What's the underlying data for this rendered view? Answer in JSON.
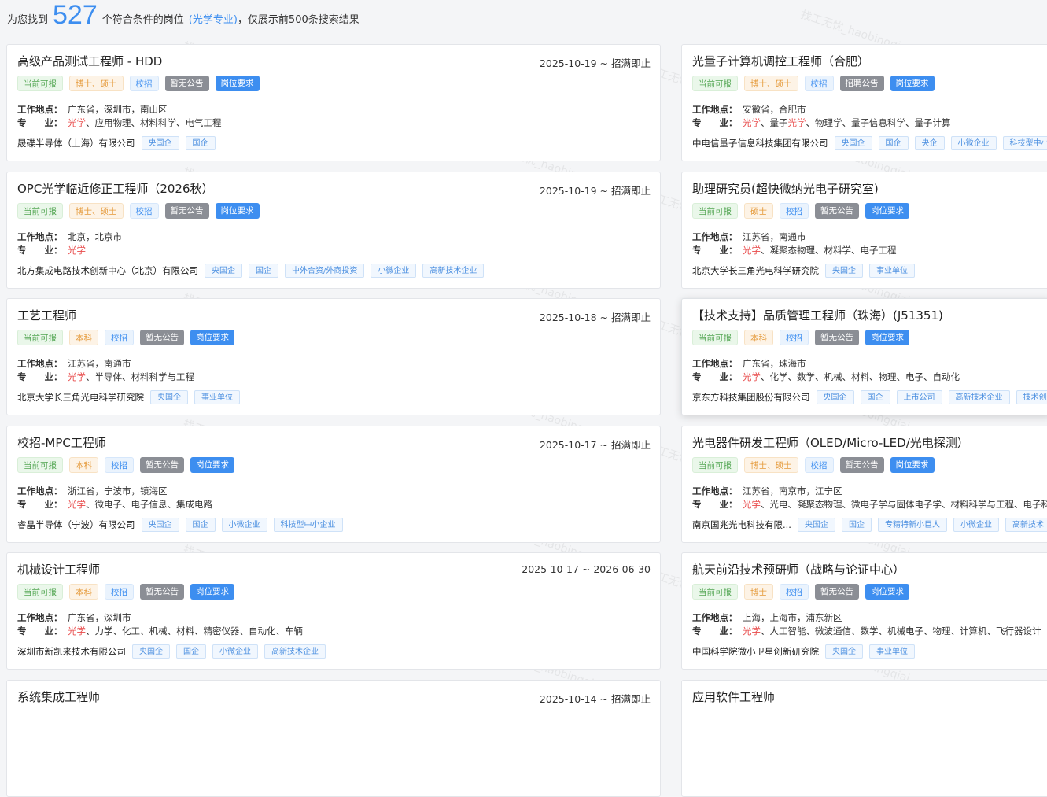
{
  "summary": {
    "prefix": "为您找到",
    "count": "527",
    "middle": "个符合条件的岗位",
    "major": "(光学专业)",
    "suffix": "，仅展示前500条搜索结果"
  },
  "labels": {
    "location": "工作地点：",
    "major": "专　　业："
  },
  "watermark": "找工无忧_haobingqiai",
  "left_jobs": [
    {
      "title": "高级产品测试工程师 - HDD",
      "date": "2025-10-19 ~ 招满即止",
      "tags": [
        "当前可报",
        "博士、硕士",
        "校招",
        "暂无公告",
        "岗位要求"
      ],
      "location": "广东省，深圳市，南山区",
      "major_hl": "光学",
      "major_rest": "、应用物理、材料科学、电气工程",
      "company": "晟碟半导体（上海）有限公司",
      "company_tags": [
        "央国企",
        "国企"
      ]
    },
    {
      "title": "OPC光学临近修正工程师（2026秋）",
      "date": "2025-10-19 ~ 招满即止",
      "tags": [
        "当前可报",
        "博士、硕士",
        "校招",
        "暂无公告",
        "岗位要求"
      ],
      "location": "北京，北京市",
      "major_hl": "光学",
      "major_rest": "",
      "company": "北方集成电路技术创新中心（北京）有限公司",
      "company_tags": [
        "央国企",
        "国企",
        "中外合资/外商投资",
        "小微企业",
        "高新技术企业"
      ]
    },
    {
      "title": "工艺工程师",
      "date": "2025-10-18 ~ 招满即止",
      "tags": [
        "当前可报",
        "本科",
        "校招",
        "暂无公告",
        "岗位要求"
      ],
      "location": "江苏省，南通市",
      "major_hl": "光学",
      "major_rest": "、半导体、材料科学与工程",
      "company": "北京大学长三角光电科学研究院",
      "company_tags": [
        "央国企",
        "事业单位"
      ]
    },
    {
      "title": "校招-MPC工程师",
      "date": "2025-10-17 ~ 招满即止",
      "tags": [
        "当前可报",
        "本科",
        "校招",
        "暂无公告",
        "岗位要求"
      ],
      "location": "浙江省，宁波市，镇海区",
      "major_hl": "光学",
      "major_rest": "、微电子、电子信息、集成电路",
      "company": "睿晶半导体（宁波）有限公司",
      "company_tags": [
        "央国企",
        "国企",
        "小微企业",
        "科技型中小企业"
      ]
    },
    {
      "title": "机械设计工程师",
      "date": "2025-10-17 ~ 2026-06-30",
      "tags": [
        "当前可报",
        "本科",
        "校招",
        "暂无公告",
        "岗位要求"
      ],
      "location": "广东省，深圳市",
      "major_hl": "光学",
      "major_rest": "、力学、化工、机械、材料、精密仪器、自动化、车辆",
      "company": "深圳市新凯来技术有限公司",
      "company_tags": [
        "央国企",
        "国企",
        "小微企业",
        "高新技术企业"
      ]
    },
    {
      "title": "系统集成工程师",
      "date": "2025-10-14 ~ 招满即止"
    }
  ],
  "right_jobs": [
    {
      "title": "光量子计算机调控工程师（合肥）",
      "tags": [
        "当前可报",
        "博士、硕士",
        "校招",
        "招聘公告",
        "岗位要求"
      ],
      "location": "安徽省，合肥市",
      "major_hl": "光学",
      "major_mid": "、量子",
      "major_hl2": "光学",
      "major_rest": "、物理学、量子信息科学、量子计算",
      "company": "中电信量子信息科技集团有限公司",
      "company_tags": [
        "央国企",
        "国企",
        "央企",
        "小微企业",
        "科技型中小企业"
      ]
    },
    {
      "title": "助理研究员(超快微纳光电子研究室)",
      "tags": [
        "当前可报",
        "硕士",
        "校招",
        "暂无公告",
        "岗位要求"
      ],
      "location": "江苏省，南通市",
      "major_hl": "光学",
      "major_rest": "、凝聚态物理、材料学、电子工程",
      "company": "北京大学长三角光电科学研究院",
      "company_tags": [
        "央国企",
        "事业单位"
      ]
    },
    {
      "title": "【技术支持】品质管理工程师（珠海）(J51351)",
      "tags": [
        "当前可报",
        "本科",
        "校招",
        "暂无公告",
        "岗位要求"
      ],
      "location": "广东省，珠海市",
      "major_hl": "光学",
      "major_rest": "、化学、数学、机械、材料、物理、电子、自动化",
      "company": "京东方科技集团股份有限公司",
      "company_tags": [
        "央国企",
        "国企",
        "上市公司",
        "高新技术企业",
        "技术创新"
      ]
    },
    {
      "title": "光电器件研发工程师（OLED/Micro-LED/光电探测）",
      "tags": [
        "当前可报",
        "博士、硕士",
        "校招",
        "暂无公告",
        "岗位要求"
      ],
      "location": "江苏省，南京市，江宁区",
      "major_hl": "光学",
      "major_rest": "、光电、凝聚态物理、微电子学与固体电子学、材料科学与工程、电子科",
      "company": "南京国兆光电科技有限...",
      "company_tags": [
        "央国企",
        "国企",
        "专精特新小巨人",
        "小微企业",
        "高新技术"
      ]
    },
    {
      "title": "航天前沿技术预研师（战略与论证中心）",
      "tags": [
        "当前可报",
        "博士",
        "校招",
        "暂无公告",
        "岗位要求"
      ],
      "location": "上海，上海市，浦东新区",
      "major_hl": "光学",
      "major_rest": "、人工智能、微波通信、数学、机械电子、物理、计算机、飞行器设计",
      "company": "中国科学院微小卫星创新研究院",
      "company_tags": [
        "央国企",
        "事业单位"
      ]
    },
    {
      "title": "应用软件工程师"
    }
  ]
}
